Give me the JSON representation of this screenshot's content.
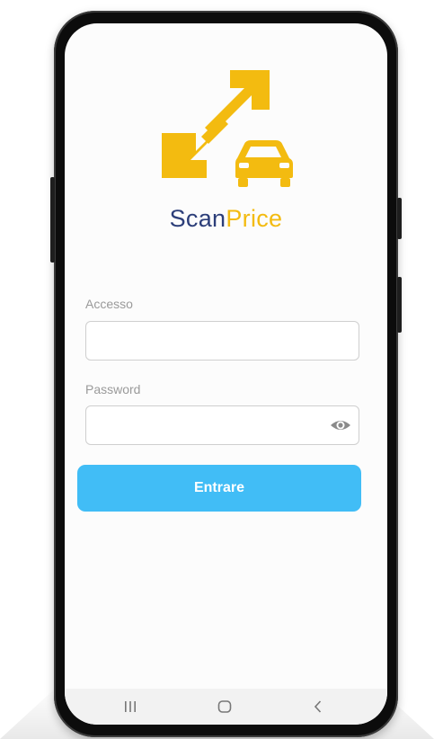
{
  "app": {
    "brand_part1": "Scan",
    "brand_part2": "Price",
    "brand_colors": {
      "scan": "#2c3e79",
      "price": "#f3bb10"
    },
    "logo_icon": "double-arrow-car-logo"
  },
  "login": {
    "username_label": "Accesso",
    "username_value": "",
    "password_label": "Password",
    "password_value": "",
    "password_toggle_icon": "eye-icon",
    "submit_label": "Entrare",
    "accent_color": "#41bdf6"
  },
  "navbar": {
    "items": [
      "recent-apps-icon",
      "home-icon",
      "back-icon"
    ]
  }
}
